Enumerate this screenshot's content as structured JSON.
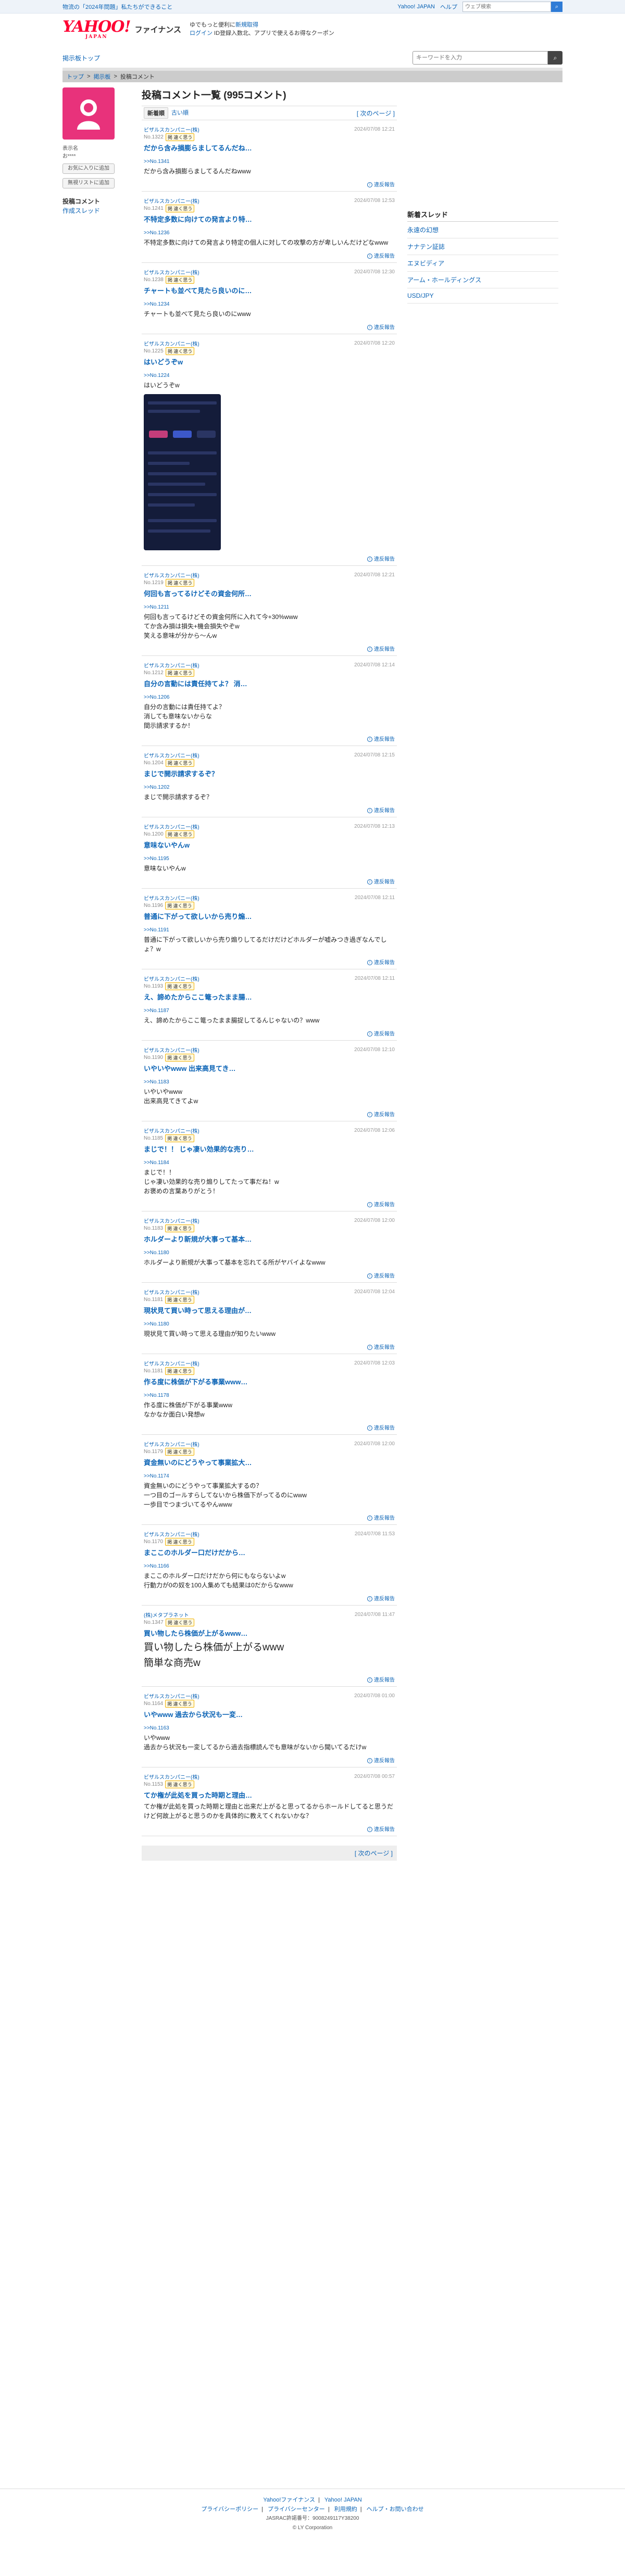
{
  "promo": {
    "text": "物流の「2024年問題」私たちができること"
  },
  "util": {
    "yahoo": "Yahoo! JAPAN",
    "help": "ヘルプ",
    "search_placeholder": "ウェブ検索",
    "search_icon": "search-icon"
  },
  "header": {
    "logo": "YAHOO!",
    "logo_sub": "JAPAN",
    "service": "ファイナンス",
    "tagline1": "ゆでもっと便利に",
    "tagline1_link": "新規取得",
    "login": "ログイン",
    "tagline2": "ID登録入数北、アプリで使えるお得なクーポン"
  },
  "nav": {
    "top_link": "掲示板トップ",
    "search_placeholder": "キーワードを入力"
  },
  "breadcrumb": [
    "トップ",
    "掲示板",
    "投稿コメント"
  ],
  "sidebar": {
    "profile_label": "表示名",
    "profile_name": "お****",
    "follow_button": "お気に入りに追加",
    "block_button": "無視リストに追加",
    "links": [
      "投稿コメント",
      "作成スレッド"
    ]
  },
  "main": {
    "title": "投稿コメント一覧 (995コメント)",
    "tab_new": "新着順",
    "tab_old": "古い順",
    "pager": "[ 次のページ ]"
  },
  "report_label": "違反報告",
  "badge": "掲 違く思う",
  "comments": [
    {
      "stock": "ビザルスカンパニー(株)",
      "no": "No.1322",
      "date": "2024/07/08 12:21",
      "title": "だから含み損膨らましてるんだね…",
      "reply": ">>No.1341",
      "body": "だから含み損膨らましてるんだねwww",
      "big": false,
      "shot": false
    },
    {
      "stock": "ビザルスカンパニー(株)",
      "no": "No.1241",
      "date": "2024/07/08 12:53",
      "title": "不特定多数に向けての発言より特…",
      "reply": ">>No.1236",
      "body": "不特定多数に向けての発言より特定の個人に対しての攻撃の方が卑しいんだけどなwww",
      "big": false,
      "shot": false
    },
    {
      "stock": "ビザルスカンパニー(株)",
      "no": "No.1238",
      "date": "2024/07/08 12:30",
      "title": "チャートも並べて見たら良いのに…",
      "reply": ">>No.1234",
      "body": "チャートも並べて見たら良いのにwww",
      "big": false,
      "shot": false
    },
    {
      "stock": "ビザルスカンパニー(株)",
      "no": "No.1225",
      "date": "2024/07/08 12:20",
      "title": "はいどうぞw",
      "reply": ">>No.1224",
      "body": "はいどうぞw",
      "big": false,
      "shot": true
    },
    {
      "stock": "ビザルスカンパニー(株)",
      "no": "No.1219",
      "date": "2024/07/08 12:21",
      "title": "何回も言ってるけどその資金何所…",
      "reply": ">>No.1211",
      "body": "何回も言ってるけどその資金何所に入れて今+30%www\nてか含み損は損失+機会損失やぞw\n笑える意味が分から〜んw",
      "big": false,
      "shot": false
    },
    {
      "stock": "ビザルスカンパニー(株)",
      "no": "No.1212",
      "date": "2024/07/08 12:14",
      "title": "自分の言動には責任持てよ？ 消…",
      "reply": ">>No.1206",
      "body": "自分の言動には責任持てよ？\n消しても意味ないからな\n間示請求するか！",
      "big": false,
      "shot": false
    },
    {
      "stock": "ビザルスカンパニー(株)",
      "no": "No.1204",
      "date": "2024/07/08 12:15",
      "title": "まじで開示請求するぞ？",
      "reply": ">>No.1202",
      "body": "まじで開示請求するぞ？",
      "big": false,
      "shot": false
    },
    {
      "stock": "ビザルスカンパニー(株)",
      "no": "No.1200",
      "date": "2024/07/08 12:13",
      "title": "意味ないやんw",
      "reply": ">>No.1195",
      "body": "意味ないやんw",
      "big": false,
      "shot": false
    },
    {
      "stock": "ビザルスカンパニー(株)",
      "no": "No.1196",
      "date": "2024/07/08 12:11",
      "title": "普通に下がって欲しいから売り煽…",
      "reply": ">>No.1191",
      "body": "普通に下がって欲しいから売り煽りしてるだけだけどホルダーが嘘みつき過ぎなんでしょ？w",
      "big": false,
      "shot": false
    },
    {
      "stock": "ビザルスカンパニー(株)",
      "no": "No.1193",
      "date": "2024/07/08 12:11",
      "title": "え、諦めたからここ篭ったまま腸…",
      "reply": ">>No.1187",
      "body": "え、諦めたからここ篭ったまま腸捉してるんじゃないの？www",
      "big": false,
      "shot": false
    },
    {
      "stock": "ビザルスカンパニー(株)",
      "no": "No.1190",
      "date": "2024/07/08 12:10",
      "title": "いやいやwww 出来高見てき…",
      "reply": ">>No.1183",
      "body": "いやいやwww\n出来高見てきてよw",
      "big": false,
      "shot": false
    },
    {
      "stock": "ビザルスカンパニー(株)",
      "no": "No.1185",
      "date": "2024/07/08 12:06",
      "title": "まじで！！ じゃ凄い効果的な売り…",
      "reply": ">>No.1184",
      "body": "まじで！！\nじゃ凄い効果的な売り煽りしてたって事だね！w\nお褒めの言葉ありがとう！",
      "big": false,
      "shot": false
    },
    {
      "stock": "ビザルスカンパニー(株)",
      "no": "No.1183",
      "date": "2024/07/08 12:00",
      "title": "ホルダーより新規が大事って基本…",
      "reply": ">>No.1180",
      "body": "ホルダーより新規が大事って基本を忘れてる所がヤバイよなwww",
      "big": false,
      "shot": false
    },
    {
      "stock": "ビザルスカンパニー(株)",
      "no": "No.1181",
      "date": "2024/07/08 12:04",
      "title": "現状見て買い時って思える理由が…",
      "reply": ">>No.1180",
      "body": "現状見て買い時って思える理由が知りたいwww",
      "big": false,
      "shot": false
    },
    {
      "stock": "ビザルスカンパニー(株)",
      "no": "No.1181",
      "date": "2024/07/08 12:03",
      "title": "作る度に株価が下がる事業www…",
      "reply": ">>No.1178",
      "body": "作る度に株価が下がる事業www\nなかなか面白い発想w",
      "big": false,
      "shot": false
    },
    {
      "stock": "ビザルスカンパニー(株)",
      "no": "No.1179",
      "date": "2024/07/08 12:00",
      "title": "資金無いのにどうやって事業拡大…",
      "reply": ">>No.1174",
      "body": "資金無いのにどうやって事業拡大するの？\n一つ目のゴールすらしてないから株価下がってるのにwww\n一歩目でつまづいてるやんwww",
      "big": false,
      "shot": false
    },
    {
      "stock": "ビザルスカンパニー(株)",
      "no": "No.1170",
      "date": "2024/07/08 11:53",
      "title": "まここのホルダー口だけだから…",
      "reply": ">>No.1166",
      "body": "まここのホルダー口だけだから何にもならないよw\n行動力が0の奴を100人集めても結果は0だからなwww",
      "big": false,
      "shot": false
    },
    {
      "stock": "(株)メタプラネット",
      "no": "No.1347",
      "date": "2024/07/08 11:47",
      "title": "買い物したら株価が上がるwww…",
      "reply": "",
      "body": "買い物したら株価が上がるwww\n簡単な商売w",
      "big": true,
      "shot": false
    },
    {
      "stock": "ビザルスカンパニー(株)",
      "no": "No.1164",
      "date": "2024/07/08 01:00",
      "title": "いやwww 過去から状況も一変…",
      "reply": ">>No.1163",
      "body": "いやwww\n過去から状況も一変してるから過去指標読んでも意味がないから聞いてるだけw",
      "big": false,
      "shot": false
    },
    {
      "stock": "ビザルスカンパニー(株)",
      "no": "No.1153",
      "date": "2024/07/08 00:57",
      "title": "てか権が此処を買った時期と理由…",
      "reply": "",
      "body": "てか権が此処を買った時期と理由と出来だ上がると思ってるからホールドしてると思うだけど何故上がると思うのかを具体的に教えてくれないかな？",
      "big": false,
      "shot": false
    }
  ],
  "right": {
    "heading": "新着スレッド",
    "items": [
      "永遠の幻想",
      "ナナテン証誌",
      "エヌビディア",
      "アーム・ホールディングス",
      "USD/JPY"
    ]
  },
  "footer": {
    "links1": [
      "Yahoo!ファイナンス",
      "Yahoo! JAPAN"
    ],
    "links2": [
      "プライバシーポリシー",
      "プライバシーセンター",
      "利用規約",
      "ヘルプ・お問い合わせ"
    ],
    "line3": "JASRAC許諾番号：9008249117Y38200",
    "copyright": "© LY Corporation"
  }
}
